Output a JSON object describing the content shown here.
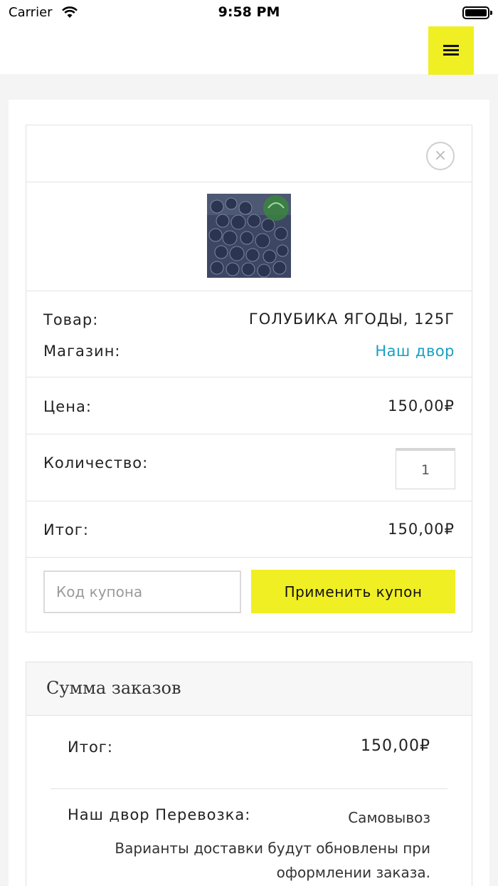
{
  "status_bar": {
    "carrier": "Carrier",
    "time": "9:58 PM"
  },
  "accent_color": "#f0ef24",
  "link_color": "#1a9fc2",
  "cart": {
    "remove_icon": "×",
    "product_label": "Товар:",
    "product_value": "ГОЛУБИКА ЯГОДЫ, 125Г",
    "shop_label": "Магазин:",
    "shop_value": "Наш двор",
    "price_label": "Цена:",
    "price_value": "150,00₽",
    "quantity_label": "Количество:",
    "quantity_value": "1",
    "total_label": "Итог:",
    "total_value": "150,00₽",
    "coupon_placeholder": "Код купона",
    "coupon_button": "Применить купон"
  },
  "summary": {
    "title": "Сумма заказов",
    "total_label": "Итог:",
    "total_value": "150,00₽",
    "shipping_label": "Наш двор Перевозка:",
    "shipping_value": "Самовывоз",
    "shipping_note": "Варианты доставки будут обновлены при оформлении заказа."
  }
}
